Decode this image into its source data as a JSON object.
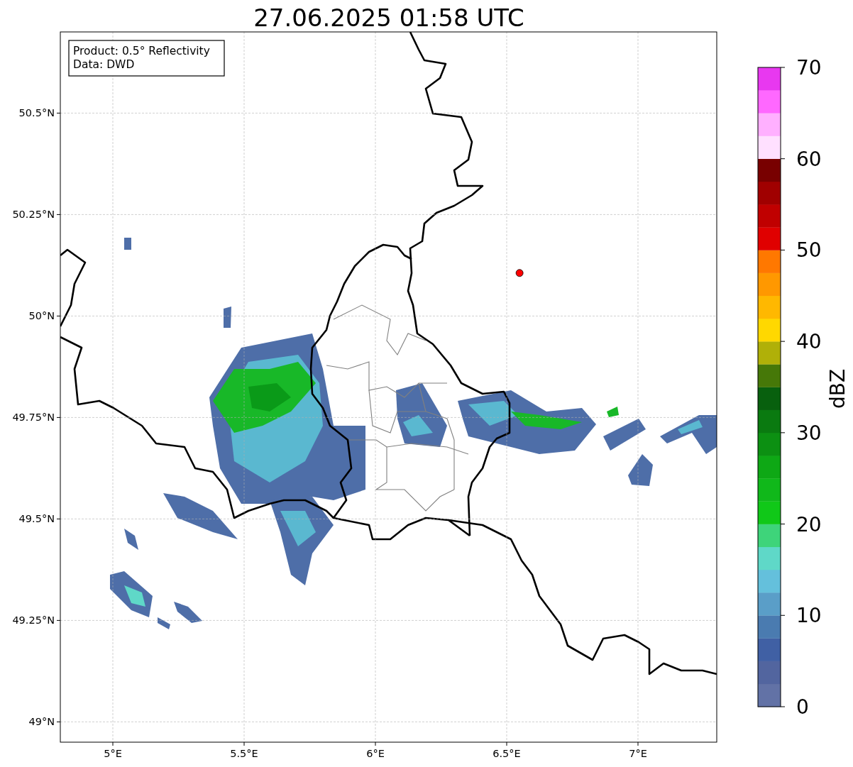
{
  "title": "27.06.2025 01:58 UTC",
  "annotation": [
    "Product: 0.5° Reflectivity",
    "Data: DWD"
  ],
  "map": {
    "chart_data": {
      "type": "scatter",
      "xlim": [
        4.8,
        7.3
      ],
      "ylim": [
        48.95,
        50.7
      ],
      "xticks": [
        {
          "value": 5,
          "label": "5°E"
        },
        {
          "value": 5.5,
          "label": "5.5°E"
        },
        {
          "value": 6,
          "label": "6°E"
        },
        {
          "value": 6.5,
          "label": "6.5°E"
        },
        {
          "value": 7,
          "label": "7°E"
        }
      ],
      "yticks": [
        {
          "value": 49,
          "label": "49°N"
        },
        {
          "value": 49.25,
          "label": "49.25°N"
        },
        {
          "value": 49.5,
          "label": "49.5°N"
        },
        {
          "value": 49.75,
          "label": "49.75°N"
        },
        {
          "value": 50,
          "label": "50°N"
        },
        {
          "value": 50.25,
          "label": "50.25°N"
        },
        {
          "value": 50.5,
          "label": "50.5°N"
        }
      ],
      "grid": true,
      "x": [
        6.549
      ],
      "series": [
        {
          "color": "#ff0000",
          "values": [
            50.106
          ]
        }
      ]
    }
  },
  "colorbar": {
    "label": "dBZ",
    "ticks": [
      "70",
      "60",
      "50",
      "40",
      "30",
      "20",
      "10",
      "0"
    ],
    "bins": [
      {
        "color": "#6272a6"
      },
      {
        "color": "#52659f"
      },
      {
        "color": "#4060a4"
      },
      {
        "color": "#4a7bb0"
      },
      {
        "color": "#5a9ec8"
      },
      {
        "color": "#64c0dc"
      },
      {
        "color": "#5fd8c8"
      },
      {
        "color": "#3ed47a"
      },
      {
        "color": "#10c818"
      },
      {
        "color": "#10b81a"
      },
      {
        "color": "#0ea815"
      },
      {
        "color": "#0c9012"
      },
      {
        "color": "#0a7a10"
      },
      {
        "color": "#08600e"
      },
      {
        "color": "#467808"
      },
      {
        "color": "#b0b008"
      },
      {
        "color": "#ffd800"
      },
      {
        "color": "#ffb800"
      },
      {
        "color": "#ff9800"
      },
      {
        "color": "#ff7800"
      },
      {
        "color": "#e00000"
      },
      {
        "color": "#c00000"
      },
      {
        "color": "#a00000"
      },
      {
        "color": "#780000"
      },
      {
        "color": "#ffe0ff"
      },
      {
        "color": "#ffb0ff"
      },
      {
        "color": "#ff68ff"
      },
      {
        "color": "#e838f0"
      }
    ]
  }
}
